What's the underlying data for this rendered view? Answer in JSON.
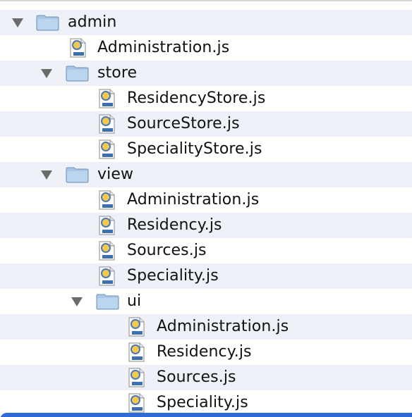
{
  "tree": {
    "rows": [
      {
        "label": "admin",
        "kind": "folder",
        "depth": 0,
        "expanded": true
      },
      {
        "label": "Administration.js",
        "kind": "file",
        "depth": 1
      },
      {
        "label": "store",
        "kind": "folder",
        "depth": 1,
        "expanded": true
      },
      {
        "label": "ResidencyStore.js",
        "kind": "file",
        "depth": 2
      },
      {
        "label": "SourceStore.js",
        "kind": "file",
        "depth": 2
      },
      {
        "label": "SpecialityStore.js",
        "kind": "file",
        "depth": 2
      },
      {
        "label": "view",
        "kind": "folder",
        "depth": 1,
        "expanded": true
      },
      {
        "label": "Administration.js",
        "kind": "file",
        "depth": 2
      },
      {
        "label": "Residency.js",
        "kind": "file",
        "depth": 2
      },
      {
        "label": "Sources.js",
        "kind": "file",
        "depth": 2
      },
      {
        "label": "Speciality.js",
        "kind": "file",
        "depth": 2
      },
      {
        "label": "ui",
        "kind": "folder",
        "depth": 2,
        "expanded": true
      },
      {
        "label": "Administration.js",
        "kind": "file",
        "depth": 3
      },
      {
        "label": "Residency.js",
        "kind": "file",
        "depth": 3
      },
      {
        "label": "Sources.js",
        "kind": "file",
        "depth": 3
      },
      {
        "label": "Speciality.js",
        "kind": "file",
        "depth": 3
      }
    ]
  },
  "icons": {
    "folder": "folder-icon",
    "file": "js-file-icon",
    "disclosure": "disclosure-triangle-expanded-icon"
  },
  "colors": {
    "row_alt": "#eef2f8",
    "row_plain": "#ffffff",
    "selection": "#2f6bd4"
  }
}
